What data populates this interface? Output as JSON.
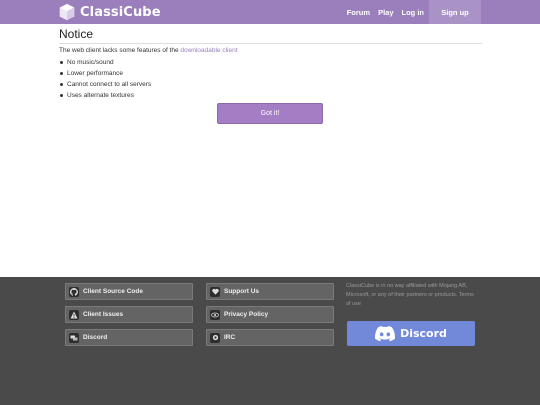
{
  "header": {
    "brand": "ClassiCube",
    "nav": {
      "forum": "Forum",
      "play": "Play",
      "login": "Log in"
    },
    "signup": "Sign up"
  },
  "notice": {
    "title": "Notice",
    "intro_text": "The web client lacks some features of the ",
    "intro_link": "downloadable client",
    "features": [
      "No music/sound",
      "Lower performance",
      "Cannot connect to all servers",
      "Uses alternate textures"
    ],
    "button": "Got it!"
  },
  "footer": {
    "links": {
      "source": {
        "label": "Client Source Code",
        "icon": "github-icon"
      },
      "support": {
        "label": "Support Us",
        "icon": "heart-icon"
      },
      "issues": {
        "label": "Client Issues",
        "icon": "warning-icon"
      },
      "privacy": {
        "label": "Privacy Policy",
        "icon": "eye-icon"
      },
      "discord": {
        "label": "Discord",
        "icon": "chat-icon"
      },
      "irc": {
        "label": "IRC",
        "icon": "irc-icon"
      }
    },
    "legal_text": "ClassiCube is in no way affiliated with Mojang AB, Microsoft, or any of their partners or products.",
    "terms_link": "Terms of use",
    "discord_banner": "Discord"
  },
  "colors": {
    "header": "#9b7fbd",
    "button": "#a37ec5",
    "footer": "#4a4a4a",
    "discord": "#7289da"
  }
}
